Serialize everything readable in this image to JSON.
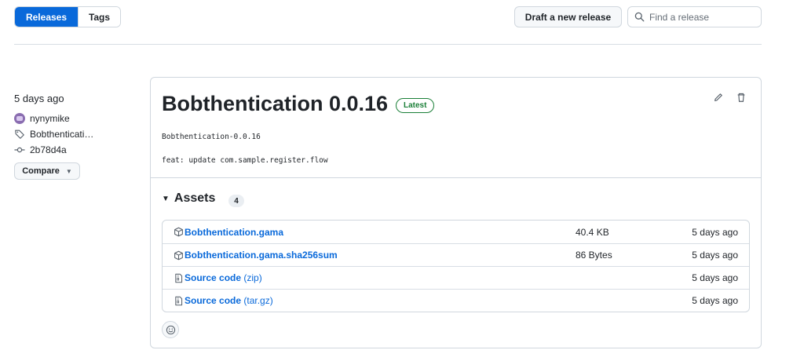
{
  "subnav": {
    "releases_label": "Releases",
    "tags_label": "Tags"
  },
  "toolbar": {
    "draft_label": "Draft a new release",
    "search_placeholder": "Find a release"
  },
  "sidebar": {
    "date": "5 days ago",
    "author": "nynymike",
    "tag": "Bobthentication-0.0.16",
    "tag_display": "Bobthenticati…",
    "commit": "2b78d4a",
    "compare_label": "Compare"
  },
  "release": {
    "title": "Bobthentication 0.0.16",
    "badge": "Latest",
    "body_line1": "Bobthentication-0.0.16",
    "body_line2": "feat: update com.sample.register.flow"
  },
  "assets": {
    "heading": "Assets",
    "count": "4",
    "items": [
      {
        "icon": "package-icon",
        "name": "Bobthentication.gama",
        "suffix": "",
        "size": "40.4 KB",
        "when": "5 days ago"
      },
      {
        "icon": "package-icon",
        "name": "Bobthentication.gama.sha256sum",
        "suffix": "",
        "size": "86 Bytes",
        "when": "5 days ago"
      },
      {
        "icon": "file-zip-icon",
        "name": "Source code",
        "suffix": " (zip)",
        "size": "",
        "when": "5 days ago"
      },
      {
        "icon": "file-zip-icon",
        "name": "Source code",
        "suffix": " (tar.gz)",
        "size": "",
        "when": "5 days ago"
      }
    ]
  },
  "colors": {
    "accent": "#0969da",
    "latest_green": "#1a7f37",
    "border": "#d0d7de"
  }
}
